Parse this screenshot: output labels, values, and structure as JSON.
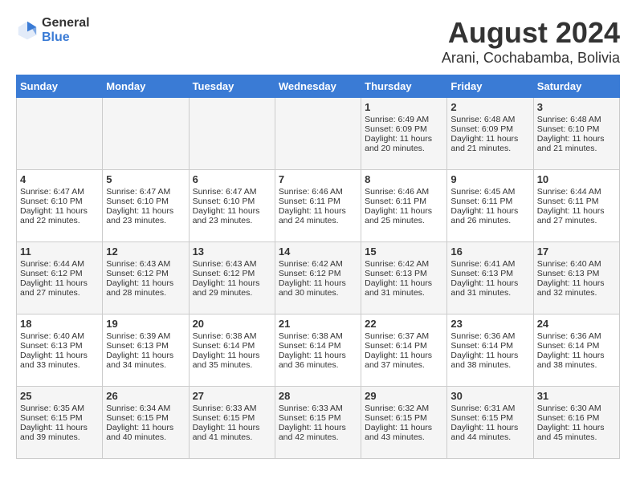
{
  "logo": {
    "line1": "General",
    "line2": "Blue"
  },
  "title": "August 2024",
  "subtitle": "Arani, Cochabamba, Bolivia",
  "days_of_week": [
    "Sunday",
    "Monday",
    "Tuesday",
    "Wednesday",
    "Thursday",
    "Friday",
    "Saturday"
  ],
  "weeks": [
    [
      {
        "day": "",
        "content": ""
      },
      {
        "day": "",
        "content": ""
      },
      {
        "day": "",
        "content": ""
      },
      {
        "day": "",
        "content": ""
      },
      {
        "day": "1",
        "content": "Sunrise: 6:49 AM\nSunset: 6:09 PM\nDaylight: 11 hours\nand 20 minutes."
      },
      {
        "day": "2",
        "content": "Sunrise: 6:48 AM\nSunset: 6:09 PM\nDaylight: 11 hours\nand 21 minutes."
      },
      {
        "day": "3",
        "content": "Sunrise: 6:48 AM\nSunset: 6:10 PM\nDaylight: 11 hours\nand 21 minutes."
      }
    ],
    [
      {
        "day": "4",
        "content": "Sunrise: 6:47 AM\nSunset: 6:10 PM\nDaylight: 11 hours\nand 22 minutes."
      },
      {
        "day": "5",
        "content": "Sunrise: 6:47 AM\nSunset: 6:10 PM\nDaylight: 11 hours\nand 23 minutes."
      },
      {
        "day": "6",
        "content": "Sunrise: 6:47 AM\nSunset: 6:10 PM\nDaylight: 11 hours\nand 23 minutes."
      },
      {
        "day": "7",
        "content": "Sunrise: 6:46 AM\nSunset: 6:11 PM\nDaylight: 11 hours\nand 24 minutes."
      },
      {
        "day": "8",
        "content": "Sunrise: 6:46 AM\nSunset: 6:11 PM\nDaylight: 11 hours\nand 25 minutes."
      },
      {
        "day": "9",
        "content": "Sunrise: 6:45 AM\nSunset: 6:11 PM\nDaylight: 11 hours\nand 26 minutes."
      },
      {
        "day": "10",
        "content": "Sunrise: 6:44 AM\nSunset: 6:11 PM\nDaylight: 11 hours\nand 27 minutes."
      }
    ],
    [
      {
        "day": "11",
        "content": "Sunrise: 6:44 AM\nSunset: 6:12 PM\nDaylight: 11 hours\nand 27 minutes."
      },
      {
        "day": "12",
        "content": "Sunrise: 6:43 AM\nSunset: 6:12 PM\nDaylight: 11 hours\nand 28 minutes."
      },
      {
        "day": "13",
        "content": "Sunrise: 6:43 AM\nSunset: 6:12 PM\nDaylight: 11 hours\nand 29 minutes."
      },
      {
        "day": "14",
        "content": "Sunrise: 6:42 AM\nSunset: 6:12 PM\nDaylight: 11 hours\nand 30 minutes."
      },
      {
        "day": "15",
        "content": "Sunrise: 6:42 AM\nSunset: 6:13 PM\nDaylight: 11 hours\nand 31 minutes."
      },
      {
        "day": "16",
        "content": "Sunrise: 6:41 AM\nSunset: 6:13 PM\nDaylight: 11 hours\nand 31 minutes."
      },
      {
        "day": "17",
        "content": "Sunrise: 6:40 AM\nSunset: 6:13 PM\nDaylight: 11 hours\nand 32 minutes."
      }
    ],
    [
      {
        "day": "18",
        "content": "Sunrise: 6:40 AM\nSunset: 6:13 PM\nDaylight: 11 hours\nand 33 minutes."
      },
      {
        "day": "19",
        "content": "Sunrise: 6:39 AM\nSunset: 6:13 PM\nDaylight: 11 hours\nand 34 minutes."
      },
      {
        "day": "20",
        "content": "Sunrise: 6:38 AM\nSunset: 6:14 PM\nDaylight: 11 hours\nand 35 minutes."
      },
      {
        "day": "21",
        "content": "Sunrise: 6:38 AM\nSunset: 6:14 PM\nDaylight: 11 hours\nand 36 minutes."
      },
      {
        "day": "22",
        "content": "Sunrise: 6:37 AM\nSunset: 6:14 PM\nDaylight: 11 hours\nand 37 minutes."
      },
      {
        "day": "23",
        "content": "Sunrise: 6:36 AM\nSunset: 6:14 PM\nDaylight: 11 hours\nand 38 minutes."
      },
      {
        "day": "24",
        "content": "Sunrise: 6:36 AM\nSunset: 6:14 PM\nDaylight: 11 hours\nand 38 minutes."
      }
    ],
    [
      {
        "day": "25",
        "content": "Sunrise: 6:35 AM\nSunset: 6:15 PM\nDaylight: 11 hours\nand 39 minutes."
      },
      {
        "day": "26",
        "content": "Sunrise: 6:34 AM\nSunset: 6:15 PM\nDaylight: 11 hours\nand 40 minutes."
      },
      {
        "day": "27",
        "content": "Sunrise: 6:33 AM\nSunset: 6:15 PM\nDaylight: 11 hours\nand 41 minutes."
      },
      {
        "day": "28",
        "content": "Sunrise: 6:33 AM\nSunset: 6:15 PM\nDaylight: 11 hours\nand 42 minutes."
      },
      {
        "day": "29",
        "content": "Sunrise: 6:32 AM\nSunset: 6:15 PM\nDaylight: 11 hours\nand 43 minutes."
      },
      {
        "day": "30",
        "content": "Sunrise: 6:31 AM\nSunset: 6:15 PM\nDaylight: 11 hours\nand 44 minutes."
      },
      {
        "day": "31",
        "content": "Sunrise: 6:30 AM\nSunset: 6:16 PM\nDaylight: 11 hours\nand 45 minutes."
      }
    ]
  ]
}
